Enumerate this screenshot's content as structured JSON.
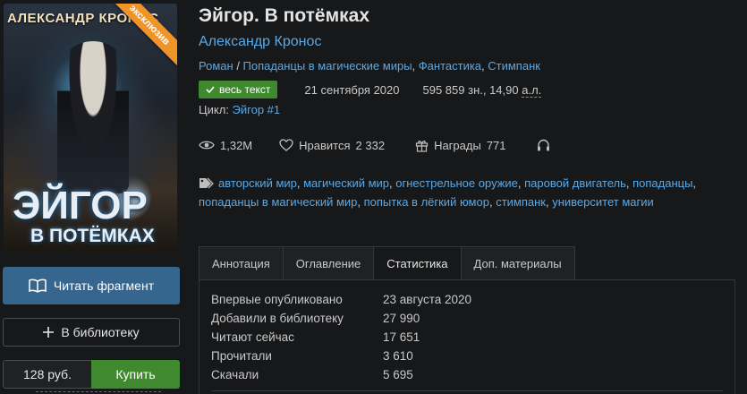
{
  "cover": {
    "author": "АЛЕКСАНДР КРОНОС",
    "title": "ЭЙГОР",
    "subtitle": "В ПОТЁМКАХ",
    "ribbon": "эксклюзив"
  },
  "actions": {
    "read_label": "Читать фрагмент",
    "library_label": "В библиотеку",
    "price": "128 руб.",
    "buy_label": "Купить"
  },
  "book": {
    "title": "Эйгор. В потёмках",
    "author": "Александр Кронос",
    "genres": [
      "Роман",
      "Попаданцы в магические миры",
      "Фантастика",
      "Стимпанк"
    ],
    "status_badge": "весь текст",
    "date": "21 сентября 2020",
    "size_chars": "595 859 зн., 14,90",
    "size_units": "а.л.",
    "cycle_label": "Цикл:",
    "cycle_value": "Эйгор #1"
  },
  "stats": {
    "views": "1,32M",
    "likes_label": "Нравится",
    "likes": "2 332",
    "awards_label": "Награды",
    "awards": "771"
  },
  "tags": [
    "авторский мир",
    "магический мир",
    "огнестрельное оружие",
    "паровой двигатель",
    "попаданцы",
    "попаданцы в магический мир",
    "попытка в лёгкий юмор",
    "стимпанк",
    "университет",
    "магии"
  ],
  "tabs": [
    "Аннотация",
    "Оглавление",
    "Статистика",
    "Доп. материалы"
  ],
  "active_tab": "Статистика",
  "statistics": [
    {
      "label": "Впервые опубликовано",
      "value": "23 августа 2020"
    },
    {
      "label": "Добавили в библиотеку",
      "value": "27 990"
    },
    {
      "label": "Читают сейчас",
      "value": "17 651"
    },
    {
      "label": "Прочитали",
      "value": "3 610"
    },
    {
      "label": "Скачали",
      "value": "5 695"
    }
  ],
  "colors": {
    "link": "#5aa9e6",
    "primary_button": "#36658d",
    "buy_button": "#3f8a2e",
    "ribbon": "#f0942a",
    "background": "#17181a"
  }
}
